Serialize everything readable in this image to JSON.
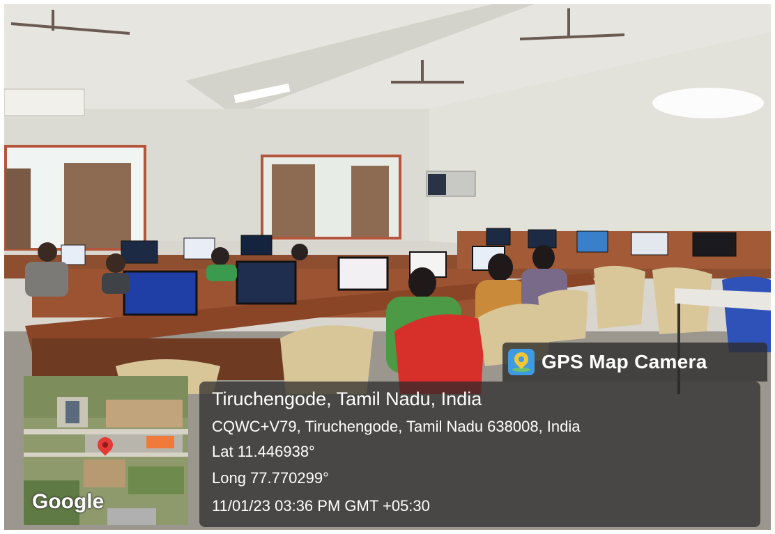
{
  "camera_app": {
    "name": "GPS Map Camera",
    "icon": "gps-map-camera-app-icon"
  },
  "location": {
    "place": "Tiruchengode, Tamil Nadu, India",
    "address": "CQWC+V79, Tiruchengode, Tamil Nadu 638008, India",
    "latitude": "Lat 11.446938°",
    "longitude": "Long 77.770299°",
    "timestamp": "11/01/23 03:36 PM GMT +05:30"
  },
  "map_thumbnail": {
    "provider_logo": "Google",
    "marker": "map-pin-icon"
  },
  "scene": {
    "subject": "computer lab with students seated at desks facing monitors",
    "colors": {
      "ceiling": "#e6e5df",
      "wall": "#dddcd5",
      "desk": "#8a4b2a",
      "floor": "#9a958c",
      "screen": "#1f3fa7",
      "chair": "#d9c79a",
      "red_chair": "#d7302b"
    }
  }
}
